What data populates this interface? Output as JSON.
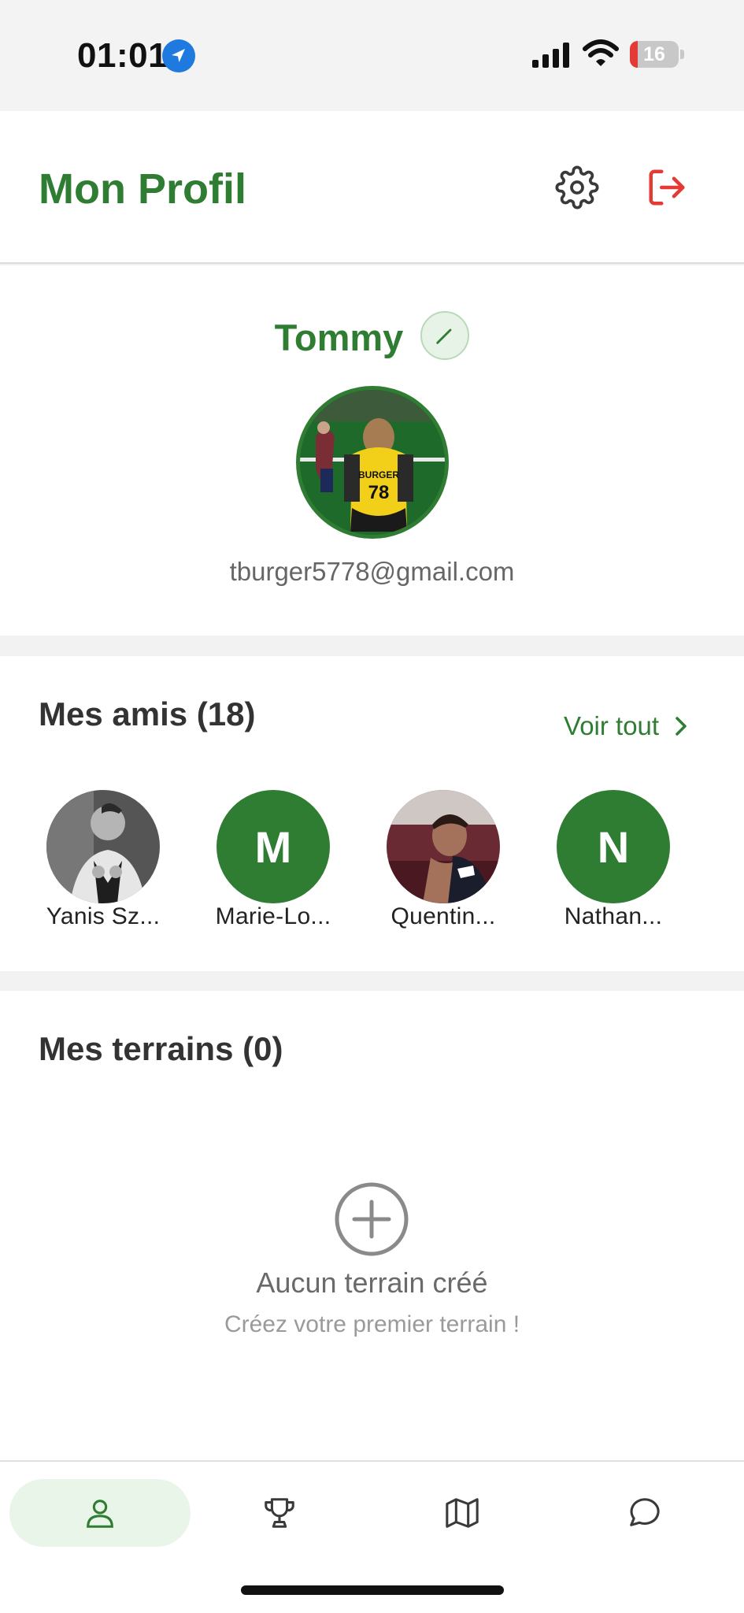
{
  "status_bar": {
    "time": "01:01",
    "battery_level": "16",
    "battery_fraction": 0.16,
    "icons": [
      "location-arrow-icon",
      "cellular-signal-icon",
      "wifi-icon",
      "battery-icon"
    ]
  },
  "header": {
    "title": "Mon Profil",
    "icons": [
      "gear-icon",
      "logout-icon"
    ]
  },
  "profile": {
    "name": "Tommy",
    "email": "tburger5778@gmail.com",
    "edit_icon": "pencil-icon"
  },
  "friends": {
    "title": "Mes amis (18)",
    "see_all": "Voir tout",
    "items": [
      {
        "name": "Yanis Sz...",
        "avatar": "photo"
      },
      {
        "name": "Marie-Lo...",
        "avatar": "initial",
        "initial": "M"
      },
      {
        "name": "Quentin...",
        "avatar": "photo"
      },
      {
        "name": "Nathan...",
        "avatar": "initial",
        "initial": "N"
      }
    ]
  },
  "terrains": {
    "title": "Mes terrains (0)",
    "empty_title": "Aucun terrain créé",
    "empty_subtitle": "Créez votre premier terrain !"
  },
  "tabbar": {
    "tabs": [
      {
        "icon": "user-icon",
        "active": true
      },
      {
        "icon": "trophy-icon",
        "active": false
      },
      {
        "icon": "map-icon",
        "active": false
      },
      {
        "icon": "chat-icon",
        "active": false
      }
    ]
  },
  "colors": {
    "accent": "#2e7d32",
    "logout": "#e53935",
    "background": "#f2f2f2"
  }
}
